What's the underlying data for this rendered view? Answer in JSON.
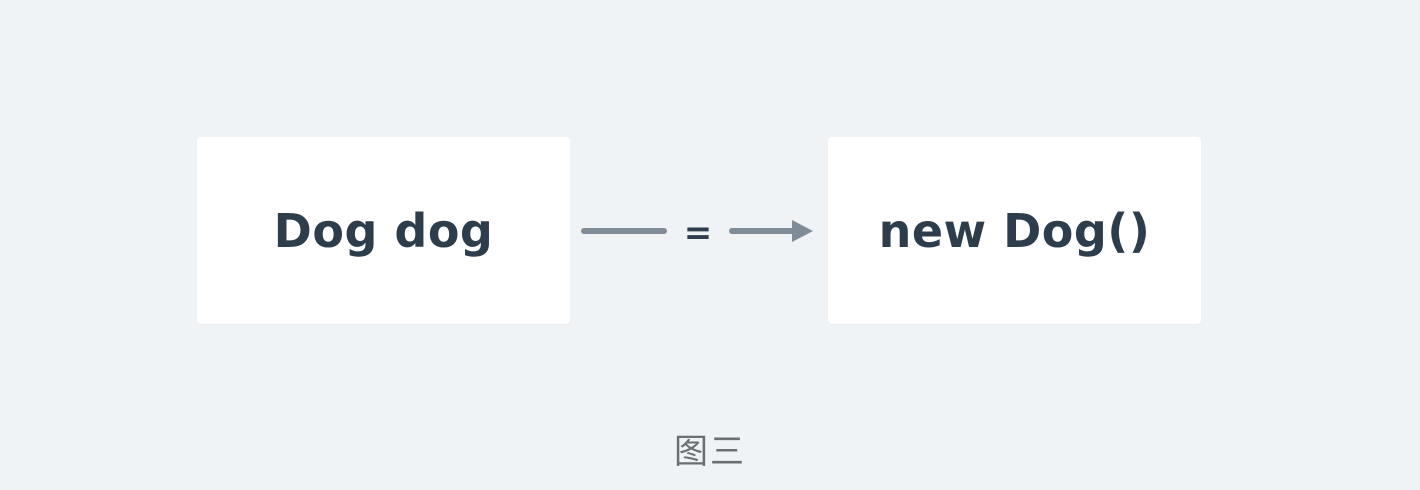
{
  "diagram": {
    "left_box": {
      "text": "Dog dog"
    },
    "right_box": {
      "text": "new Dog()"
    },
    "connector": {
      "label": "="
    },
    "caption": "图三"
  },
  "colors": {
    "background": "#eff3f6",
    "box": "#ffffff",
    "text": "#2e3d4c",
    "arrow": "#7f8c97",
    "caption": "#6b6f73"
  }
}
